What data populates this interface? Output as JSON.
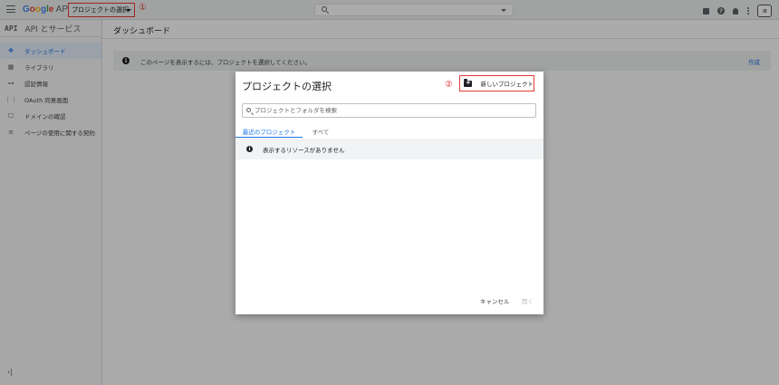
{
  "topbar": {
    "logo_google": "Google",
    "logo_apis": " APIs",
    "project_picker_label": "プロジェクトの選択",
    "annotation_1": "①",
    "avatar_text": "ഭ"
  },
  "sidebar": {
    "api_badge": "API",
    "title": "API とサービス",
    "items": [
      {
        "label": "ダッシュボード",
        "icon": "dashboard-icon",
        "glyph": "✥"
      },
      {
        "label": "ライブラリ",
        "icon": "library-icon",
        "glyph": "▦"
      },
      {
        "label": "認証情報",
        "icon": "key-icon",
        "glyph": "⊶"
      },
      {
        "label": "OAuth 同意画面",
        "icon": "consent-icon",
        "glyph": "⋮⋮"
      },
      {
        "label": "ドメインの確認",
        "icon": "domain-icon",
        "glyph": "☐"
      },
      {
        "label": "ページの使用に関する契約",
        "icon": "agreement-icon",
        "glyph": "≡"
      }
    ],
    "collapse_glyph": "‹|"
  },
  "main": {
    "title": "ダッシュボード",
    "notice_text": "このページを表示するには、プロジェクトを選択してください。",
    "notice_action": "作成"
  },
  "dialog": {
    "title": "プロジェクトの選択",
    "annotation_2": "②",
    "new_project_label": "新しいプロジェクト",
    "search_placeholder": "プロジェクトとフォルダを検索",
    "tabs": [
      {
        "label": "最近のプロジェクト"
      },
      {
        "label": "すべて"
      }
    ],
    "empty_message": "表示するリソースがありません",
    "cancel_label": "キャンセル",
    "open_label": "開く"
  },
  "colors": {
    "accent": "#1a73e8",
    "annotation_red": "#e53935",
    "overlay": "rgba(0,0,0,0.33)"
  }
}
